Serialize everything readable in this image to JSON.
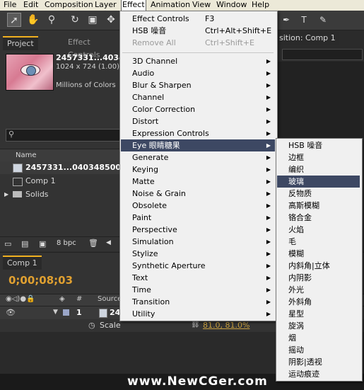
{
  "menubar": {
    "items": [
      "File",
      "Edit",
      "Composition",
      "Layer",
      "Effect",
      "Animation",
      "View",
      "Window",
      "Help"
    ],
    "active": "Effect"
  },
  "toolbar": {
    "tools": [
      "selection-tool",
      "hand-tool",
      "zoom-tool",
      "rotate-tool",
      "camera-tool",
      "pan-behind-tool",
      "rectangle-tool",
      "pen-tool",
      "text-tool"
    ]
  },
  "project_panel": {
    "tab_label": "Project",
    "effect_controls_tab": "Effect Controls",
    "item_name": "2457331...4034",
    "item_dims": "1024 x 724 (1.00)",
    "item_colors": "Millions of Colors",
    "search_icon": "search-icon",
    "column_name": "Name",
    "files": [
      "2457331...0403485000",
      "Comp 1",
      "Solids"
    ],
    "bpc_label": "8 bpc"
  },
  "comp_panel": {
    "tab_label": "Comp 1",
    "timecode": "0;00;08;03",
    "header_layer": "Source",
    "layer_index": "1",
    "layer_name": "24",
    "property": "Scale",
    "property_value": "81.0, 81.0%"
  },
  "composition_tab": "sition: Comp 1",
  "effect_menu": {
    "items": [
      {
        "label": "Effect Controls",
        "shortcut": "F3",
        "type": "item"
      },
      {
        "label": "HSB 噪音",
        "shortcut": "Ctrl+Alt+Shift+E",
        "type": "item"
      },
      {
        "label": "Remove All",
        "shortcut": "Ctrl+Shift+E",
        "type": "disabled"
      },
      {
        "type": "separator"
      },
      {
        "label": "3D Channel",
        "type": "submenu"
      },
      {
        "label": "Audio",
        "type": "submenu"
      },
      {
        "label": "Blur & Sharpen",
        "type": "submenu"
      },
      {
        "label": "Channel",
        "type": "submenu"
      },
      {
        "label": "Color Correction",
        "type": "submenu"
      },
      {
        "label": "Distort",
        "type": "submenu"
      },
      {
        "label": "Expression Controls",
        "type": "submenu"
      },
      {
        "label": "Eye 眼睛糖果",
        "type": "submenu",
        "highlighted": true
      },
      {
        "label": "Generate",
        "type": "submenu"
      },
      {
        "label": "Keying",
        "type": "submenu"
      },
      {
        "label": "Matte",
        "type": "submenu"
      },
      {
        "label": "Noise & Grain",
        "type": "submenu"
      },
      {
        "label": "Obsolete",
        "type": "submenu"
      },
      {
        "label": "Paint",
        "type": "submenu"
      },
      {
        "label": "Perspective",
        "type": "submenu"
      },
      {
        "label": "Simulation",
        "type": "submenu"
      },
      {
        "label": "Stylize",
        "type": "submenu"
      },
      {
        "label": "Synthetic Aperture",
        "type": "submenu"
      },
      {
        "label": "Text",
        "type": "submenu"
      },
      {
        "label": "Time",
        "type": "submenu"
      },
      {
        "label": "Transition",
        "type": "submenu"
      },
      {
        "label": "Utility",
        "type": "submenu"
      }
    ]
  },
  "eye_submenu": {
    "items": [
      "HSB 噪音",
      "边框",
      "编织",
      "玻璃",
      "反物质",
      "高斯模糊",
      "铬合金",
      "火焰",
      "毛",
      "模糊",
      "内斜角|立体",
      "内阴影",
      "外光",
      "外斜角",
      "星型",
      "旋涡",
      "烟",
      "摇动",
      "阴影|透视",
      "运动痕迹"
    ],
    "highlighted_index": 3
  },
  "watermark": "www.NewCGer.com",
  "colors": {
    "menu_bg": "#f0f0f0",
    "menu_highlight": "#3d4863",
    "timecode": "#e0a030",
    "value_link": "#c8a040"
  }
}
